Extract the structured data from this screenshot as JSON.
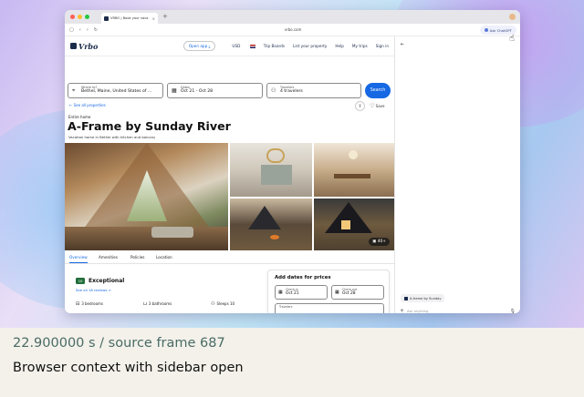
{
  "browser": {
    "tab_title": "VRBO | Book your vaca",
    "tab_close": "×",
    "new_tab": "+",
    "url": "vrbo.com",
    "ask_button": "Ask ChatGPT",
    "colors": {
      "close": "#ff5f57",
      "minimize": "#febc2e",
      "maximize": "#28c840"
    }
  },
  "header": {
    "logo": "Vrbo",
    "open_app": "Open app ⤓",
    "currency": "USD",
    "nav": [
      "Trip Boards",
      "List your property",
      "Help",
      "My trips",
      "Sign in"
    ]
  },
  "search": {
    "where_label": "Where to?",
    "where_value": "Bethel, Maine, United States of ...",
    "dates_label": "Dates",
    "dates_value": "Oct 21 - Oct 28",
    "travelers_label": "Travelers",
    "travelers_value": "4 travelers",
    "button": "Search"
  },
  "listing": {
    "see_all": "See all properties",
    "save": "Save",
    "breadcrumb": "Entire home",
    "title": "A-Frame by Sunday River",
    "subtitle": "Vacation home in Bethel with kitchen and balcony",
    "photo_count": "40+",
    "tabs": [
      "Overview",
      "Amenities",
      "Policies",
      "Location"
    ],
    "score": "10",
    "rating_label": "Exceptional",
    "reviews_link": "See all 18 reviews >",
    "features": [
      "3 bedrooms",
      "3 bathrooms",
      "Sleeps 10"
    ]
  },
  "booking": {
    "heading": "Add dates for prices",
    "checkin_label": "Check-in",
    "checkin_value": "Oct 21",
    "checkout_label": "Check-out",
    "checkout_value": "Oct 28",
    "travelers_label": "Travelers"
  },
  "sidebar": {
    "context_chip": "A-frame by Sunday",
    "input_placeholder": "Ask anything"
  },
  "captions": {
    "timestamp": "22.900000 s / source frame 687",
    "description": "Browser context with sidebar open"
  },
  "colors": {
    "brand_blue": "#1668e3",
    "brand_navy": "#1b2b4a",
    "score_green": "#216e3a"
  }
}
